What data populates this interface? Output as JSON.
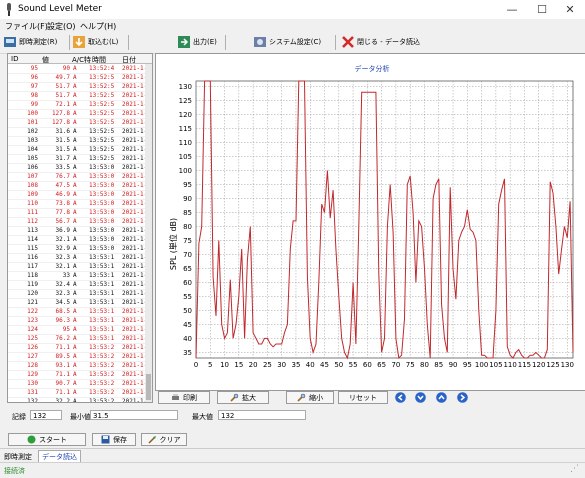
{
  "window": {
    "title": "Sound Level Meter",
    "controls": [
      "—",
      "☐",
      "✕"
    ]
  },
  "menu": [
    "ファイル(F)",
    "設定(O)",
    "ヘルプ(H)"
  ],
  "toolbar": {
    "measure": "即時測定(R)",
    "import": "取込む(L)",
    "output": "出力(E)",
    "system": "システム設定(C)",
    "close": "閉じる - データ読込"
  },
  "table": {
    "headers": [
      "ID",
      "値",
      "A/C特",
      "時間",
      "日付"
    ],
    "rows": [
      [
        "95",
        "90",
        "A",
        "13:52:4",
        "2021-1-",
        "red"
      ],
      [
        "96",
        "49.7",
        "A",
        "13:52:5",
        "2021-1-",
        "red"
      ],
      [
        "97",
        "51.7",
        "A",
        "13:52:5",
        "2021-1-",
        "red"
      ],
      [
        "98",
        "51.7",
        "A",
        "13:52:5",
        "2021-1-",
        "red"
      ],
      [
        "99",
        "72.1",
        "A",
        "13:52:5",
        "2021-1-",
        "red"
      ],
      [
        "100",
        "127.8",
        "A",
        "13:52:5",
        "2021-1-",
        "red"
      ],
      [
        "101",
        "127.8",
        "A",
        "13:52:5",
        "2021-1-",
        "red"
      ],
      [
        "102",
        "31.6",
        "A",
        "13:52:5",
        "2021-1-",
        "black"
      ],
      [
        "103",
        "31.5",
        "A",
        "13:52:5",
        "2021-1-",
        "black"
      ],
      [
        "104",
        "31.5",
        "A",
        "13:52:5",
        "2021-1-",
        "black"
      ],
      [
        "105",
        "31.7",
        "A",
        "13:52:5",
        "2021-1-",
        "black"
      ],
      [
        "106",
        "33.5",
        "A",
        "13:53:0",
        "2021-1-",
        "black"
      ],
      [
        "107",
        "76.7",
        "A",
        "13:53:0",
        "2021-1-",
        "red"
      ],
      [
        "108",
        "47.5",
        "A",
        "13:53:0",
        "2021-1-",
        "red"
      ],
      [
        "109",
        "46.9",
        "A",
        "13:53:0",
        "2021-1-",
        "red"
      ],
      [
        "110",
        "73.8",
        "A",
        "13:53:0",
        "2021-1-",
        "red"
      ],
      [
        "111",
        "77.8",
        "A",
        "13:53:0",
        "2021-1-",
        "red"
      ],
      [
        "112",
        "56.7",
        "A",
        "13:53:0",
        "2021-1-",
        "red"
      ],
      [
        "113",
        "36.9",
        "A",
        "13:53:0",
        "2021-1-",
        "black"
      ],
      [
        "114",
        "32.1",
        "A",
        "13:53:0",
        "2021-1-",
        "black"
      ],
      [
        "115",
        "32.9",
        "A",
        "13:53:0",
        "2021-1-",
        "black"
      ],
      [
        "116",
        "32.3",
        "A",
        "13:53:1",
        "2021-1-",
        "black"
      ],
      [
        "117",
        "32.1",
        "A",
        "13:53:1",
        "2021-1-",
        "black"
      ],
      [
        "118",
        "33",
        "A",
        "13:53:1",
        "2021-1-",
        "black"
      ],
      [
        "119",
        "32.4",
        "A",
        "13:53:1",
        "2021-1-",
        "black"
      ],
      [
        "120",
        "32.3",
        "A",
        "13:53:1",
        "2021-1-",
        "black"
      ],
      [
        "121",
        "34.5",
        "A",
        "13:53:1",
        "2021-1-",
        "black"
      ],
      [
        "122",
        "68.5",
        "A",
        "13:53:1",
        "2021-1-",
        "red"
      ],
      [
        "123",
        "96.3",
        "A",
        "13:53:1",
        "2021-1-",
        "red"
      ],
      [
        "124",
        "95",
        "A",
        "13:53:1",
        "2021-1-",
        "red"
      ],
      [
        "125",
        "76.2",
        "A",
        "13:53:1",
        "2021-1-",
        "red"
      ],
      [
        "126",
        "71.1",
        "A",
        "13:53:2",
        "2021-1-",
        "red"
      ],
      [
        "127",
        "89.5",
        "A",
        "13:53:2",
        "2021-1-",
        "red"
      ],
      [
        "128",
        "93.1",
        "A",
        "13:53:2",
        "2021-1-",
        "red"
      ],
      [
        "129",
        "71.1",
        "A",
        "13:53:2",
        "2021-1-",
        "red"
      ],
      [
        "130",
        "90.7",
        "A",
        "13:53:2",
        "2021-1-",
        "red"
      ],
      [
        "131",
        "71.1",
        "A",
        "13:53:2",
        "2021-1-",
        "red"
      ],
      [
        "132",
        "32.2",
        "A",
        "13:53:2",
        "2021-1-",
        "black"
      ]
    ]
  },
  "chart_data": {
    "type": "line",
    "title": "データ分析",
    "ylabel": "SPL (単位 dB)",
    "xlabel": "",
    "xlim": [
      0,
      132
    ],
    "ylim": [
      33,
      132
    ],
    "xticks": [
      0,
      5,
      10,
      15,
      20,
      25,
      30,
      35,
      40,
      45,
      50,
      55,
      60,
      65,
      70,
      75,
      80,
      85,
      90,
      95,
      100,
      105,
      110,
      115,
      120,
      125,
      130
    ],
    "yticks": [
      35,
      40,
      45,
      50,
      55,
      60,
      65,
      70,
      75,
      80,
      85,
      90,
      95,
      100,
      105,
      110,
      115,
      120,
      125,
      130
    ],
    "grid": true,
    "color": "#c0282d",
    "x": [
      0,
      1,
      2,
      3,
      4,
      5,
      6,
      7,
      8,
      9,
      10,
      11,
      12,
      13,
      14,
      15,
      16,
      17,
      18,
      19,
      20,
      21,
      22,
      23,
      24,
      25,
      26,
      27,
      28,
      29,
      30,
      31,
      32,
      33,
      34,
      35,
      36,
      37,
      38,
      39,
      40,
      41,
      42,
      43,
      44,
      45,
      46,
      47,
      48,
      49,
      50,
      51,
      52,
      53,
      54,
      55,
      56,
      57,
      58,
      59,
      60,
      61,
      62,
      63,
      64,
      65,
      66,
      67,
      68,
      69,
      70,
      71,
      72,
      73,
      74,
      75,
      76,
      77,
      78,
      79,
      80,
      81,
      82,
      83,
      84,
      85,
      86,
      87,
      88,
      89,
      90,
      91,
      92,
      93,
      94,
      95,
      96,
      97,
      98,
      99,
      100,
      101,
      102,
      103,
      104,
      105,
      106,
      107,
      108,
      109,
      110,
      111,
      112,
      113,
      114,
      115,
      116,
      117,
      118,
      119,
      120,
      121,
      122,
      123,
      124,
      125,
      126,
      127,
      128,
      129,
      130,
      131,
      132
    ],
    "y": [
      33,
      74,
      80,
      132,
      132,
      132,
      62,
      48,
      75,
      45,
      40,
      42,
      61,
      40,
      45,
      55,
      72,
      40,
      68,
      80,
      42,
      40,
      38,
      38,
      40,
      40,
      38,
      37,
      38,
      38,
      38,
      42,
      45,
      72,
      82,
      82,
      132,
      132,
      132,
      62,
      40,
      35,
      38,
      60,
      88,
      85,
      100,
      83,
      93,
      72,
      55,
      40,
      35,
      33,
      38,
      60,
      38,
      80,
      128,
      128,
      128,
      128,
      128,
      128,
      63,
      35,
      40,
      80,
      95,
      78,
      40,
      33,
      34,
      47,
      95,
      98,
      85,
      60,
      82,
      80,
      65,
      45,
      33,
      90,
      95,
      97,
      52,
      40,
      35,
      94,
      65,
      54,
      75,
      78,
      80,
      86,
      79,
      78,
      75,
      50,
      34,
      34,
      33,
      33,
      33,
      50,
      88,
      93,
      97,
      37,
      34,
      33,
      35,
      36,
      34,
      33,
      33,
      34,
      34,
      35,
      34,
      33,
      33,
      36,
      96,
      92,
      80,
      63,
      72,
      80,
      76,
      89,
      35
    ]
  },
  "controls": {
    "print": "印刷",
    "zoom_in": "拡大",
    "zoom_out": "縮小",
    "reset": "リセット"
  },
  "fields": {
    "record_label": "記録",
    "record_value": "132",
    "min_label": "最小値",
    "min_value": "31.5",
    "max_label": "最大値",
    "max_value": "132"
  },
  "actions": {
    "start": "スタート",
    "save": "保存",
    "clear": "クリア"
  },
  "tabs": [
    "即時測定",
    "データ読込"
  ],
  "status": "接続済"
}
